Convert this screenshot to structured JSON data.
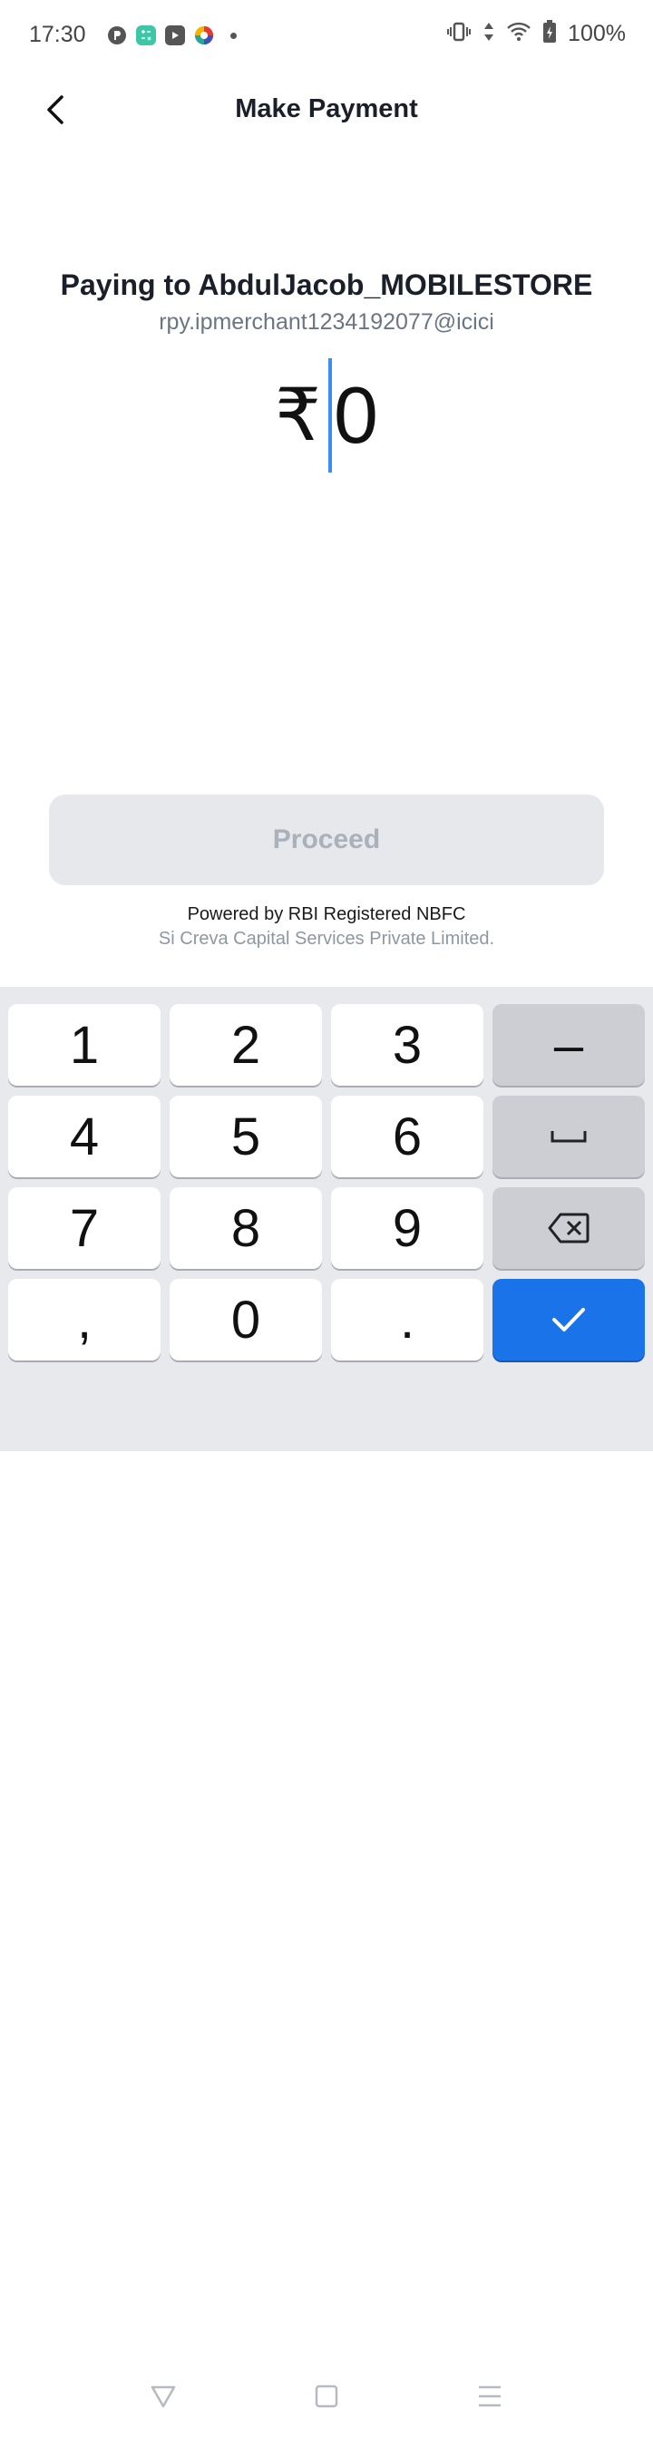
{
  "status_bar": {
    "time": "17:30",
    "battery": "100%"
  },
  "header": {
    "title": "Make Payment",
    "back_icon": "chevron-left-icon"
  },
  "payee": {
    "paying_to": "Paying to AbdulJacob_MOBILESTORE",
    "vpa": "rpy.ipmerchant1234192077@icici"
  },
  "amount": {
    "currency_symbol": "₹",
    "value": "0"
  },
  "proceed_label": "Proceed",
  "footer": {
    "powered_by": "Powered by RBI Registered NBFC",
    "nbfc_name": "Si Creva Capital Services Private Limited."
  },
  "keyboard": {
    "keys": [
      "1",
      "2",
      "3",
      "4",
      "5",
      "6",
      "7",
      "8",
      "9",
      ",",
      "0",
      "."
    ],
    "minus": "–"
  },
  "colors": {
    "accent": "#1a73e8",
    "caret": "#3b8df1",
    "proceed_disabled_bg": "#e6e8eb",
    "proceed_disabled_text": "#a9b1ba"
  }
}
